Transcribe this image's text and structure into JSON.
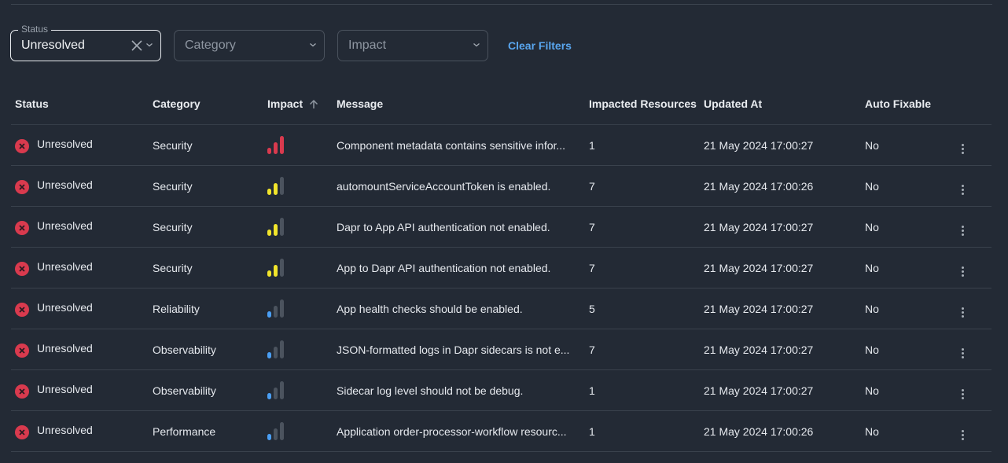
{
  "filters": {
    "status": {
      "label": "Status",
      "value": "Unresolved"
    },
    "category": {
      "placeholder": "Category"
    },
    "impact": {
      "placeholder": "Impact"
    },
    "clear_label": "Clear Filters"
  },
  "colors": {
    "background": "#232a35",
    "accent": "#59a6ef",
    "status_unresolved": "#d93a4e",
    "impact_high": "#d93a4e",
    "impact_medium": "#f2e52b",
    "impact_low": "#4a9ff5",
    "impact_inactive": "#4b535e"
  },
  "table": {
    "columns": [
      {
        "key": "status",
        "label": "Status"
      },
      {
        "key": "category",
        "label": "Category"
      },
      {
        "key": "impact",
        "label": "Impact",
        "sort": "ascending"
      },
      {
        "key": "message",
        "label": "Message"
      },
      {
        "key": "impacted_resources",
        "label": "Impacted Resources"
      },
      {
        "key": "updated_at",
        "label": "Updated At"
      },
      {
        "key": "auto_fixable",
        "label": "Auto Fixable"
      }
    ],
    "rows": [
      {
        "status": "Unresolved",
        "category": "Security",
        "impact": "high",
        "message": "Component metadata contains sensitive infor...",
        "impacted_resources": "1",
        "updated_at": "21 May 2024 17:00:27",
        "auto_fixable": "No"
      },
      {
        "status": "Unresolved",
        "category": "Security",
        "impact": "medium",
        "message": "automountServiceAccountToken is enabled.",
        "impacted_resources": "7",
        "updated_at": "21 May 2024 17:00:26",
        "auto_fixable": "No"
      },
      {
        "status": "Unresolved",
        "category": "Security",
        "impact": "medium",
        "message": "Dapr to App API authentication not enabled.",
        "impacted_resources": "7",
        "updated_at": "21 May 2024 17:00:27",
        "auto_fixable": "No"
      },
      {
        "status": "Unresolved",
        "category": "Security",
        "impact": "medium",
        "message": "App to Dapr API authentication not enabled.",
        "impacted_resources": "7",
        "updated_at": "21 May 2024 17:00:27",
        "auto_fixable": "No"
      },
      {
        "status": "Unresolved",
        "category": "Reliability",
        "impact": "low",
        "message": "App health checks should be enabled.",
        "impacted_resources": "5",
        "updated_at": "21 May 2024 17:00:27",
        "auto_fixable": "No"
      },
      {
        "status": "Unresolved",
        "category": "Observability",
        "impact": "low",
        "message": "JSON-formatted logs in Dapr sidecars is not e...",
        "impacted_resources": "7",
        "updated_at": "21 May 2024 17:00:27",
        "auto_fixable": "No"
      },
      {
        "status": "Unresolved",
        "category": "Observability",
        "impact": "low",
        "message": "Sidecar log level should not be debug.",
        "impacted_resources": "1",
        "updated_at": "21 May 2024 17:00:27",
        "auto_fixable": "No"
      },
      {
        "status": "Unresolved",
        "category": "Performance",
        "impact": "low",
        "message": "Application order-processor-workflow resourc...",
        "impacted_resources": "1",
        "updated_at": "21 May 2024 17:00:26",
        "auto_fixable": "No"
      }
    ]
  }
}
